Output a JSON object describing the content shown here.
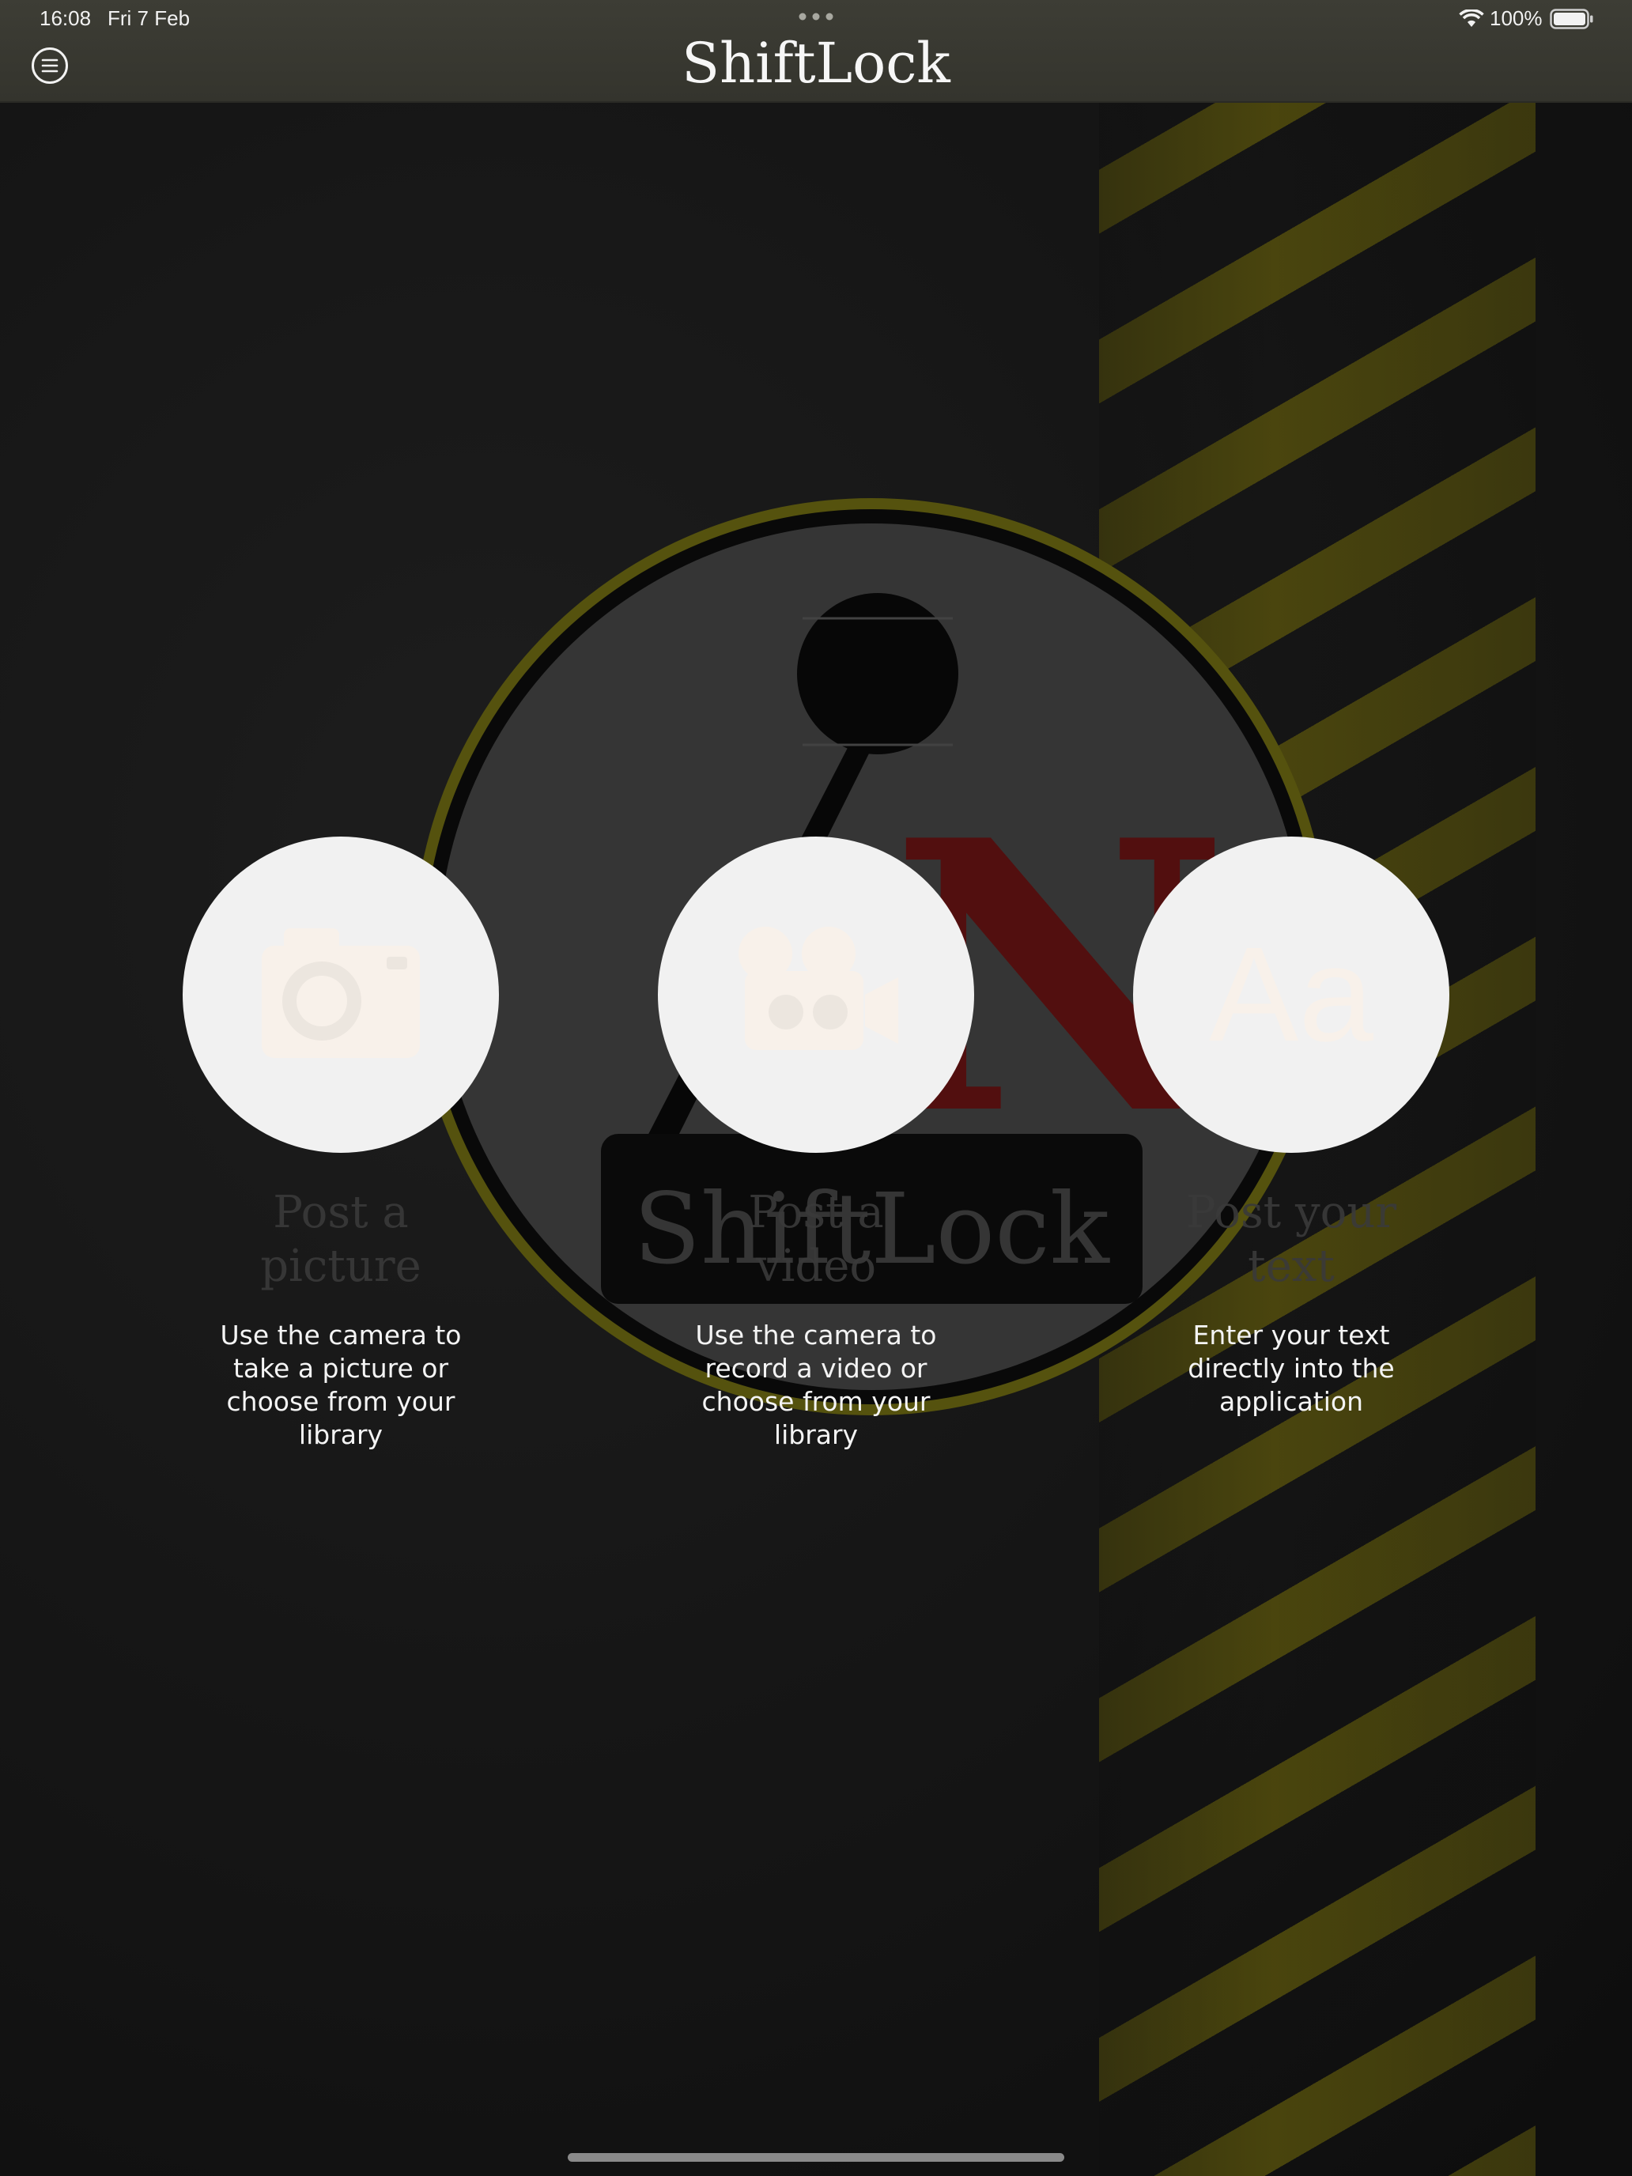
{
  "status_bar": {
    "time": "16:08",
    "date": "Fri 7 Feb",
    "battery_percent": "100%",
    "icons": [
      "wifi-icon",
      "battery-icon",
      "multitask-dots-icon"
    ]
  },
  "nav": {
    "title": "ShiftLock",
    "menu_icon": "menu-icon"
  },
  "logo": {
    "text": "ShiftLock",
    "letter": "N",
    "colors": {
      "ring_outer": "#6d6a12",
      "ring_inner": "#0c0c0c",
      "disc": "#454545",
      "letter": "#6a1414",
      "knob": "#0a0a0a"
    }
  },
  "options": [
    {
      "icon": "camera-icon",
      "title": "Post a picture",
      "description": "Use the camera to take a picture or choose from your library"
    },
    {
      "icon": "video-camera-icon",
      "title": "Post a video",
      "description": "Use the camera to record a video or choose from your library"
    },
    {
      "icon": "text-aa-icon",
      "title": "Post your text",
      "description": "Enter your text directly into the application",
      "icon_glyph": "Aa"
    }
  ],
  "colors": {
    "hazard_yellow": "#6b6410",
    "topbar": "#3a3a33",
    "circle": "#f1f1f1"
  }
}
